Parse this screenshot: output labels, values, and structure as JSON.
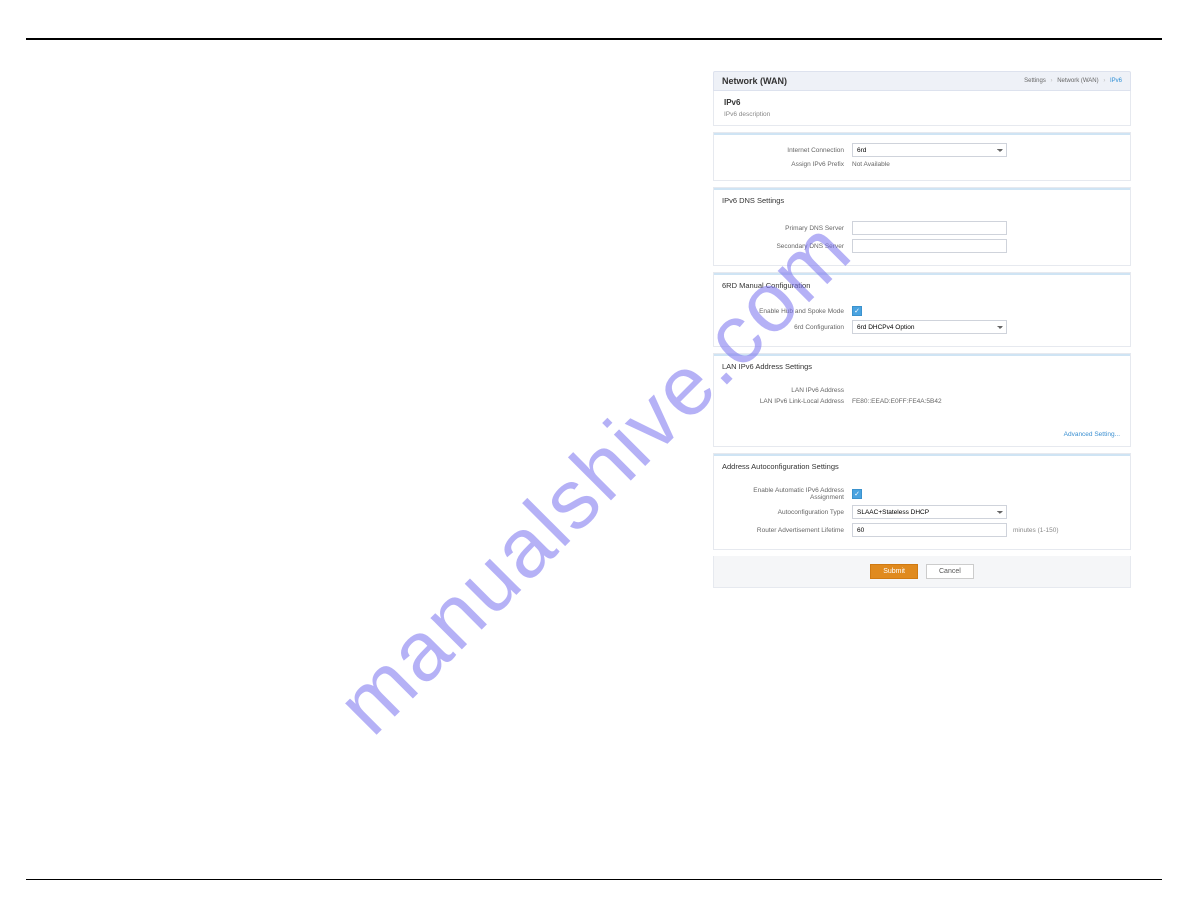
{
  "watermark": "manualshive.com",
  "header": {
    "title": "Network (WAN)",
    "crumbs": [
      "Settings",
      "Network (WAN)",
      "IPv6"
    ]
  },
  "intro": {
    "heading": "IPv6",
    "desc": "IPv6 description"
  },
  "connection": {
    "internet_label": "Internet Connection",
    "internet_value": "6rd",
    "assign_label": "Assign IPv6 Prefix",
    "assign_value": "Not Available"
  },
  "dns": {
    "title": "IPv6 DNS Settings",
    "primary_label": "Primary DNS Server",
    "primary_value": "",
    "secondary_label": "Secondary DNS Server",
    "secondary_value": ""
  },
  "sixrd": {
    "title": "6RD Manual Configuration",
    "hub_label": "Enable Hub and Spoke Mode",
    "hub_checked": true,
    "config_label": "6rd Configuration",
    "config_value": "6rd DHCPv4 Option"
  },
  "lan": {
    "title": "LAN IPv6 Address Settings",
    "addr_label": "LAN IPv6 Address",
    "addr_value": "",
    "ll_label": "LAN IPv6 Link-Local Address",
    "ll_value": "FE80::EEAD:E0FF:FE4A:5B42",
    "advanced": "Advanced Setting..."
  },
  "auto": {
    "title": "Address Autoconfiguration Settings",
    "enable_label": "Enable Automatic IPv6 Address Assignment",
    "enable_checked": true,
    "type_label": "Autoconfiguration Type",
    "type_value": "SLAAC+Stateless DHCP",
    "ra_label": "Router Advertisement Lifetime",
    "ra_value": "60",
    "ra_hint": "minutes (1-150)"
  },
  "buttons": {
    "submit": "Submit",
    "cancel": "Cancel"
  }
}
